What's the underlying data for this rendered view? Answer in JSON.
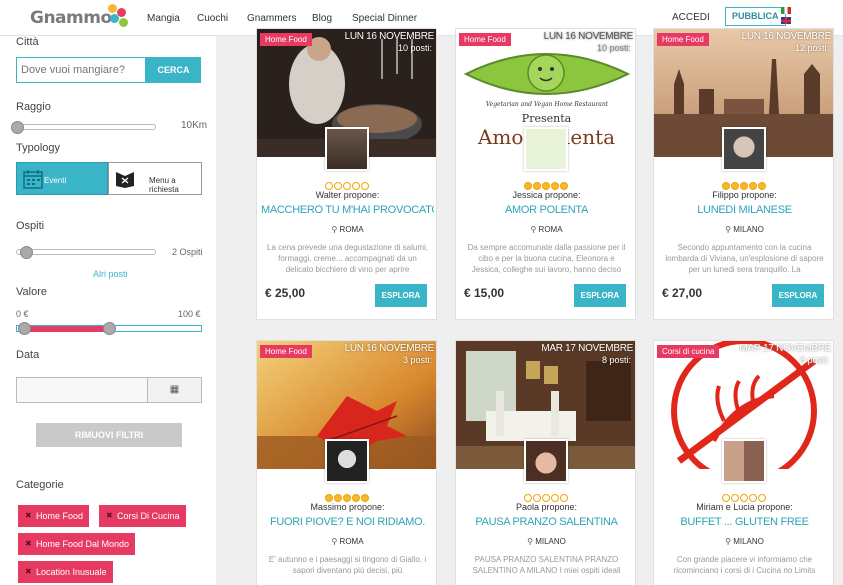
{
  "header": {
    "logo": "Gnammo",
    "nav": [
      "Mangia",
      "Cuochi",
      "Gnammers",
      "Blog",
      "Special Dinner"
    ],
    "login": "ACCEDI",
    "publish": "PUBBLICA"
  },
  "sidebar": {
    "city_label": "Città",
    "city_placeholder": "Dove vuoi mangiare?",
    "search_button": "CERCA",
    "radius_label": "Raggio",
    "radius_value": "10Km",
    "radius_level": 0,
    "typology_label": "Typology",
    "typology_events": "Eventi",
    "typology_menu": "Menu a richiesta",
    "guests_label": "Ospiti",
    "guests_value": "2 Ospiti",
    "more_seats": "Alri posti",
    "value_label": "Valore",
    "value_min": "0 €",
    "value_max": "100 €",
    "date_label": "Data",
    "remove_filters": "RIMUOVI FILTRI",
    "categories_label": "Categorie",
    "categories": [
      "Home Food",
      "Corsi Di Cucina",
      "Home Food Dal Mondo",
      "Location Inusuale"
    ]
  },
  "cards": [
    {
      "badge": "Home Food",
      "date": "LUN 16 NOVEMBRE",
      "seats": "10 posti:",
      "host": "Walter propone:",
      "title": "MACCHERÒ TU M'HAI PROVOCATO...",
      "city": "ROMA",
      "description": "La cena prevede una degustazione di salumi, formaggi, creme... accompagnati da un delicato bicchiere di vino per aprire",
      "price": "€ 25,00",
      "button": "ESPLORA",
      "rating": 0
    },
    {
      "badge": "Home Food",
      "date": "LUN 16 NOVEMBRE",
      "seats": "10 posti:",
      "host": "Jessica propone:",
      "title": "AMOR POLENTA",
      "city": "ROMA",
      "description": "Da sempre accomunate dalla passione per il cibo e per la buona cucina, Eleonora e Jessica, colleghe sui lavoro, hanno deciso",
      "price": "€ 15,00",
      "button": "ESPLORA",
      "rating": 5,
      "photo_text_1": "Vegetarian and Vegan Home Restaurant",
      "photo_text_2": "Presenta",
      "photo_text_3": "Amor Polenta"
    },
    {
      "badge": "Home Food",
      "date": "LUN 16 NOVEMBRE",
      "seats": "12 posti:",
      "host": "Filippo propone:",
      "title": "LUNEDÌ MILANESE",
      "city": "MILANO",
      "description": "Secondo appuntamento con la cucina lombarda di Viviana, un'esplosione di sapore per un lunedi sera tranquillo. La",
      "price": "€ 27,00",
      "button": "ESPLORA",
      "rating": 5
    },
    {
      "badge": "Home Food",
      "date": "LUN 16 NOVEMBRE",
      "seats": "3 posti:",
      "host": "Massimo propone:",
      "title": "FUORI PIOVE? E NOI RIDIAMO.",
      "city": "ROMA",
      "description": "E' autunno e i paesaggi si tingono di Giallo, i sapori diventano più decisi, più",
      "rating": 5
    },
    {
      "badge": "",
      "date": "MAR 17 NOVEMBRE",
      "seats": "8 posti:",
      "host": "Paola propone:",
      "title": "PAUSA PRANZO SALENTINA",
      "city": "MILANO",
      "description": "PAUSA PRANZO SALENTINA PRANZO SALENTINO A MILANO I miei ospiti ideali",
      "rating": 0
    },
    {
      "badge": "Corsi di cucina",
      "date": "MAR 17 NOVEMBRE",
      "seats": "8 posti:",
      "host": "Miriam e Lucia propone:",
      "title": "BUFFET ... GLUTEN FREE",
      "city": "MILANO",
      "description": "Con grande piacere vi informiamo che ricominciano i corsi di i Cucina no Limits",
      "rating": 0
    }
  ]
}
